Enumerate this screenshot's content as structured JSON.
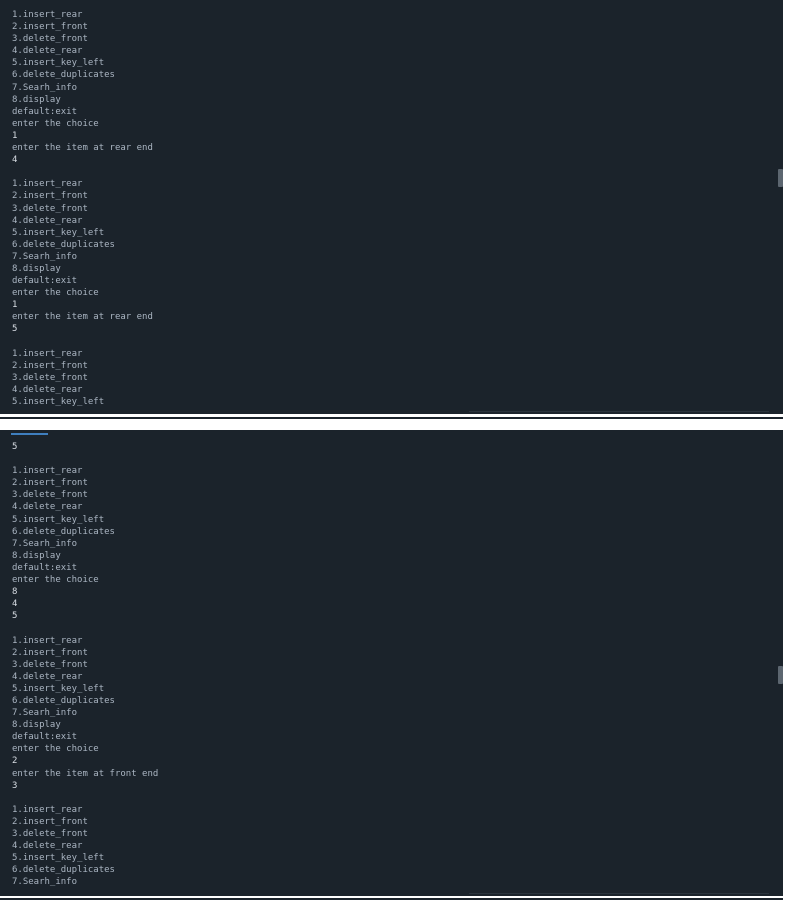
{
  "terminal_top": {
    "lines": [
      "1.insert_rear",
      "2.insert_front",
      "3.delete_front",
      "4.delete_rear",
      "5.insert_key_left",
      "6.delete_duplicates",
      "7.Searh_info",
      "8.display",
      "default:exit",
      "enter the choice",
      "1",
      "enter the item at rear end",
      "4",
      "",
      "1.insert_rear",
      "2.insert_front",
      "3.delete_front",
      "4.delete_rear",
      "5.insert_key_left",
      "6.delete_duplicates",
      "7.Searh_info",
      "8.display",
      "default:exit",
      "enter the choice",
      "1",
      "enter the item at rear end",
      "5",
      "",
      "1.insert_rear",
      "2.insert_front",
      "3.delete_front",
      "4.delete_rear",
      "5.insert_key_left"
    ]
  },
  "terminal_bottom": {
    "lines": [
      "5",
      "",
      "1.insert_rear",
      "2.insert_front",
      "3.delete_front",
      "4.delete_rear",
      "5.insert_key_left",
      "6.delete_duplicates",
      "7.Searh_info",
      "8.display",
      "default:exit",
      "enter the choice",
      "8",
      "4",
      "5",
      "",
      "1.insert_rear",
      "2.insert_front",
      "3.delete_front",
      "4.delete_rear",
      "5.insert_key_left",
      "6.delete_duplicates",
      "7.Searh_info",
      "8.display",
      "default:exit",
      "enter the choice",
      "2",
      "enter the item at front end",
      "3",
      "",
      "1.insert_rear",
      "2.insert_front",
      "3.delete_front",
      "4.delete_rear",
      "5.insert_key_left",
      "6.delete_duplicates",
      "7.Searh_info"
    ]
  },
  "colors": {
    "background": "#1b232b",
    "text": "#aab5c2",
    "accent": "#3f7fbf"
  }
}
